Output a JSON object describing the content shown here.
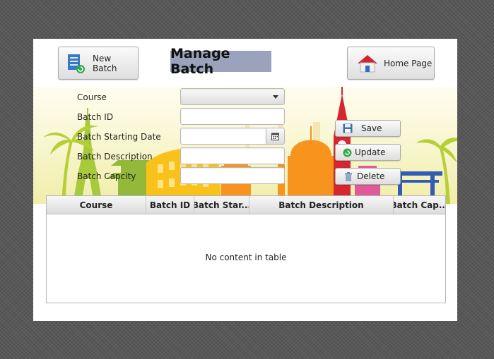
{
  "header": {
    "new_batch_label": "New Batch",
    "title": "Manage Batch",
    "home_label": "Home Page"
  },
  "form": {
    "course_label": "Course",
    "course_value": "",
    "batch_id_label": "Batch ID",
    "batch_id_value": "",
    "start_date_label": "Batch Starting Date",
    "start_date_value": "",
    "description_label": "Batch Description",
    "description_value": "",
    "capacity_label": "Batch Capcity",
    "capacity_value": ""
  },
  "actions": {
    "save_label": "Save",
    "update_label": "Update",
    "delete_label": "Delete"
  },
  "table": {
    "columns": [
      "Course",
      "Batch ID",
      "Batch Star...",
      "Batch Description",
      "Batch Cap..."
    ],
    "empty_text": "No content in table"
  },
  "icons": {
    "new_batch": "document-refresh-icon",
    "home": "house-icon",
    "save": "floppy-disk-icon",
    "update": "refresh-icon",
    "delete": "trash-icon",
    "calendar": "calendar-icon",
    "dropdown": "chevron-down-icon"
  },
  "colors": {
    "title_highlight": "#9aa3bb",
    "banner_orange": "#f7941d",
    "banner_red": "#d7262f",
    "banner_yellow": "#fcc419",
    "banner_green": "#9ec53d",
    "banner_blue": "#2f5db5"
  }
}
